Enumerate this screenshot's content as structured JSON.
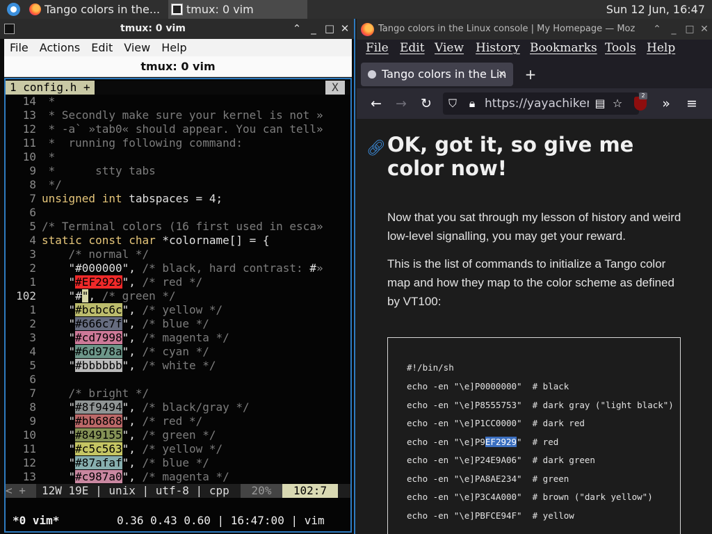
{
  "topbar": {
    "task1": "Tango colors in the...",
    "task2": "tmux: 0 vim",
    "clock": "Sun 12 Jun, 16:47"
  },
  "terminal": {
    "title": "tmux: 0 vim",
    "menu": [
      "File",
      "Actions",
      "Edit",
      "View",
      "Help"
    ],
    "tab_title": "tmux: 0 vim",
    "vim_tab": "1 config.h +",
    "vim_tab_close": "X",
    "status_left": "< +",
    "status_info": "12W 19E | unix | utf-8 | cpp",
    "status_pct": "20%",
    "status_pos": "102:7",
    "tmux_left": "*0 vim*",
    "tmux_right": "0.36 0.43 0.60 | 16:47:00 | vim"
  },
  "browser": {
    "title": "Tango colors in the Linux console | My Homepage — Moz",
    "menu": [
      "File",
      "Edit",
      "View",
      "History",
      "Bookmarks",
      "Tools",
      "Help"
    ],
    "tab_label": "Tango colors in the Lin",
    "url": "https://yayachiken",
    "ublock_badge": "2",
    "heading": "OK, got it, so give me color now!",
    "para1": "Now that you sat through my lesson of history and weird low-level signalling, you may get your reward.",
    "para2": "This is the list of commands to initialize a Tango color map and how they map to the color scheme as defined by VT100:",
    "code": {
      "shebang": "#!/bin/sh",
      "lines": [
        {
          "pre": "echo -en \"\\e]P0000000\"",
          "hl": "",
          "post": "",
          "comment": "  # black"
        },
        {
          "pre": "echo -en \"\\e]P8555753\"",
          "hl": "",
          "post": "",
          "comment": "  # dark gray (\"light black\")"
        },
        {
          "pre": "echo -en \"\\e]P1CC0000\"",
          "hl": "",
          "post": "",
          "comment": "  # dark red"
        },
        {
          "pre": "echo -en \"\\e]P9",
          "hl": "EF2929",
          "post": "\"",
          "comment": "  # red"
        },
        {
          "pre": "echo -en \"\\e]P24E9A06\"",
          "hl": "",
          "post": "",
          "comment": "  # dark green"
        },
        {
          "pre": "echo -en \"\\e]PA8AE234\"",
          "hl": "",
          "post": "",
          "comment": "  # green"
        },
        {
          "pre": "echo -en \"\\e]P3C4A000\"",
          "hl": "",
          "post": "",
          "comment": "  # brown (\"dark yellow\")"
        },
        {
          "pre": "echo -en \"\\e]PBFCE94F\"",
          "hl": "",
          "post": "",
          "comment": "  # yellow"
        }
      ]
    }
  },
  "vim_lines": [
    {
      "num": "14",
      "segs": [
        {
          "t": " *",
          "c": "cm"
        }
      ]
    },
    {
      "num": "13",
      "segs": [
        {
          "t": " * Secondly make sure your kernel is not ",
          "c": "cm"
        },
        {
          "t": "»",
          "c": "ov"
        }
      ]
    },
    {
      "num": "12",
      "segs": [
        {
          "t": " * -a` »tab0« should appear. You can tell",
          "c": "cm"
        },
        {
          "t": "»",
          "c": "ov"
        }
      ]
    },
    {
      "num": "11",
      "segs": [
        {
          "t": " *  running following command:",
          "c": "cm"
        }
      ]
    },
    {
      "num": "10",
      "segs": [
        {
          "t": " *",
          "c": "cm"
        }
      ]
    },
    {
      "num": "9",
      "segs": [
        {
          "t": " *      stty tabs",
          "c": "cm"
        }
      ]
    },
    {
      "num": "8",
      "segs": [
        {
          "t": " */",
          "c": "cm"
        }
      ]
    },
    {
      "num": "7",
      "segs": [
        {
          "t": "unsigned int",
          "c": "kw"
        },
        {
          "t": " tabspaces = 4;",
          "c": "st"
        }
      ]
    },
    {
      "num": "6",
      "segs": []
    },
    {
      "num": "5",
      "segs": [
        {
          "t": "/* Terminal colors (16 first used in esca",
          "c": "cm"
        },
        {
          "t": "»",
          "c": "ov"
        }
      ]
    },
    {
      "num": "4",
      "segs": [
        {
          "t": "static const char",
          "c": "kw"
        },
        {
          "t": " *colorname[] = {",
          "c": "st"
        }
      ]
    },
    {
      "num": "3",
      "segs": [
        {
          "t": "    /* normal */",
          "c": "cm"
        }
      ]
    },
    {
      "num": "2",
      "segs": [
        {
          "t": "    \"#000000\", ",
          "c": "st"
        },
        {
          "t": "/* black, hard contrast: ",
          "c": "cm"
        },
        {
          "t": "#",
          "c": "st"
        },
        {
          "t": "»",
          "c": "ov"
        }
      ]
    },
    {
      "num": "1",
      "segs": [
        {
          "t": "    \"",
          "c": "st"
        },
        {
          "t": "#EF2929",
          "c": "sw",
          "bg": "#ef2929"
        },
        {
          "t": "\", ",
          "c": "st"
        },
        {
          "t": "/* red */",
          "c": "cm"
        }
      ]
    },
    {
      "num": "102",
      "cur": true,
      "segs": [
        {
          "t": "    \"#",
          "c": "st"
        },
        {
          "t": "\"",
          "c": "cursor"
        },
        {
          "t": ", ",
          "c": "st"
        },
        {
          "t": "/* green */",
          "c": "cm"
        }
      ]
    },
    {
      "num": "1",
      "segs": [
        {
          "t": "    \"",
          "c": "st"
        },
        {
          "t": "#bcbc6c",
          "c": "sw",
          "bg": "#bcbc6c"
        },
        {
          "t": "\", ",
          "c": "st"
        },
        {
          "t": "/* yellow */",
          "c": "cm"
        }
      ]
    },
    {
      "num": "2",
      "segs": [
        {
          "t": "    \"",
          "c": "st"
        },
        {
          "t": "#666c7f",
          "c": "sw",
          "bg": "#666c7f"
        },
        {
          "t": "\", ",
          "c": "st"
        },
        {
          "t": "/* blue */",
          "c": "cm"
        }
      ]
    },
    {
      "num": "3",
      "segs": [
        {
          "t": "    \"",
          "c": "st"
        },
        {
          "t": "#cd7998",
          "c": "sw",
          "bg": "#cd7998"
        },
        {
          "t": "\", ",
          "c": "st"
        },
        {
          "t": "/* magenta */",
          "c": "cm"
        }
      ]
    },
    {
      "num": "4",
      "segs": [
        {
          "t": "    \"",
          "c": "st"
        },
        {
          "t": "#6d978a",
          "c": "sw",
          "bg": "#6d978a"
        },
        {
          "t": "\", ",
          "c": "st"
        },
        {
          "t": "/* cyan */",
          "c": "cm"
        }
      ]
    },
    {
      "num": "5",
      "segs": [
        {
          "t": "    \"",
          "c": "st"
        },
        {
          "t": "#bbbbbb",
          "c": "sw",
          "bg": "#bbbbbb"
        },
        {
          "t": "\", ",
          "c": "st"
        },
        {
          "t": "/* white */",
          "c": "cm"
        }
      ]
    },
    {
      "num": "6",
      "segs": []
    },
    {
      "num": "7",
      "segs": [
        {
          "t": "    /* bright */",
          "c": "cm"
        }
      ]
    },
    {
      "num": "8",
      "segs": [
        {
          "t": "    \"",
          "c": "st"
        },
        {
          "t": "#8f9494",
          "c": "sw",
          "bg": "#8f9494"
        },
        {
          "t": "\", ",
          "c": "st"
        },
        {
          "t": "/* black/gray */",
          "c": "cm"
        }
      ]
    },
    {
      "num": "9",
      "segs": [
        {
          "t": "    \"",
          "c": "st"
        },
        {
          "t": "#bb6868",
          "c": "sw",
          "bg": "#bb6868"
        },
        {
          "t": "\", ",
          "c": "st"
        },
        {
          "t": "/* red */",
          "c": "cm"
        }
      ]
    },
    {
      "num": "10",
      "segs": [
        {
          "t": "    \"",
          "c": "st"
        },
        {
          "t": "#849155",
          "c": "sw",
          "bg": "#849155"
        },
        {
          "t": "\", ",
          "c": "st"
        },
        {
          "t": "/* green */",
          "c": "cm"
        }
      ]
    },
    {
      "num": "11",
      "segs": [
        {
          "t": "    \"",
          "c": "st"
        },
        {
          "t": "#c5c563",
          "c": "sw",
          "bg": "#c5c563"
        },
        {
          "t": "\", ",
          "c": "st"
        },
        {
          "t": "/* yellow */",
          "c": "cm"
        }
      ]
    },
    {
      "num": "12",
      "segs": [
        {
          "t": "    \"",
          "c": "st"
        },
        {
          "t": "#87afaf",
          "c": "sw",
          "bg": "#87afaf"
        },
        {
          "t": "\", ",
          "c": "st"
        },
        {
          "t": "/* blue */",
          "c": "cm"
        }
      ]
    },
    {
      "num": "13",
      "segs": [
        {
          "t": "    \"",
          "c": "st"
        },
        {
          "t": "#c987a0",
          "c": "sw",
          "bg": "#c987a0"
        },
        {
          "t": "\", ",
          "c": "st"
        },
        {
          "t": "/* magenta */",
          "c": "cm"
        }
      ]
    }
  ]
}
